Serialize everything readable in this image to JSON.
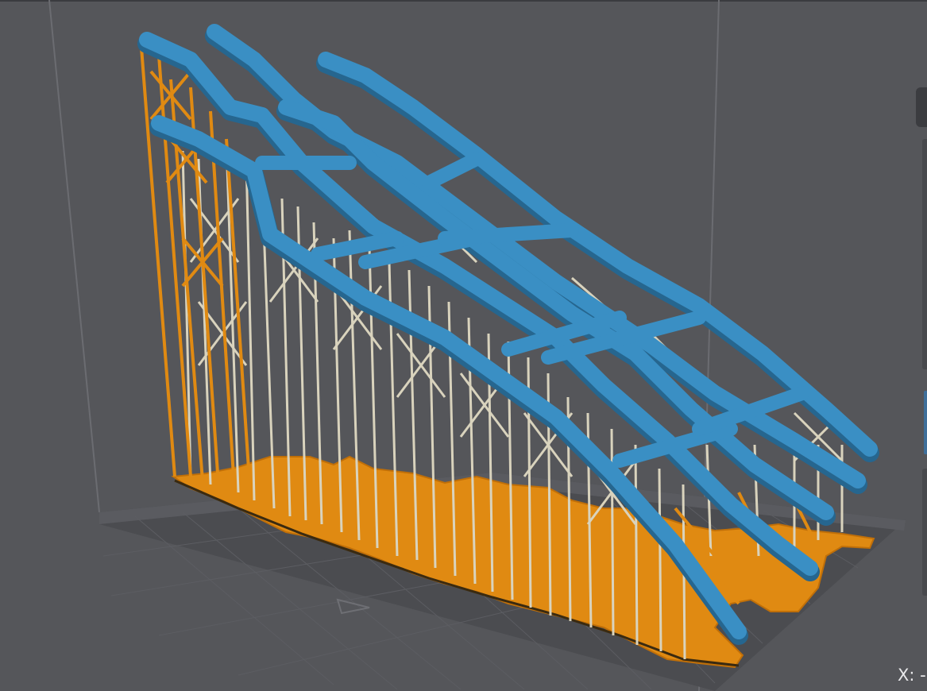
{
  "app": {
    "view": "3d-print-preview"
  },
  "colors": {
    "background": "#55565a",
    "model": "#3a8fc4",
    "model_shade": "#2a6f9c",
    "support_base": "#e8900f",
    "support_base_dark": "#b86a0a",
    "support_struts": "#d8d2bc",
    "build_plate": "#4c4d51",
    "grid_line": "#5d5e63"
  },
  "icons": [
    "orientation-arrow-icon",
    "collapse-panel-icon"
  ],
  "status_bar": {
    "coordinate_label": "X: -"
  }
}
